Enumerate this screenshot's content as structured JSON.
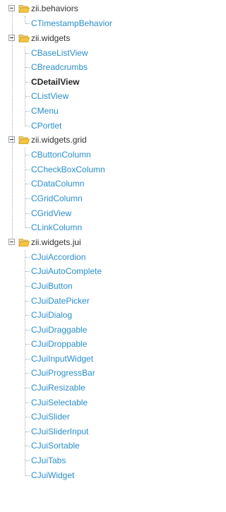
{
  "tree": {
    "groups": [
      {
        "label": "zii.behaviors",
        "items": [
          {
            "label": "CTimestampBehavior",
            "active": false
          }
        ]
      },
      {
        "label": "zii.widgets",
        "items": [
          {
            "label": "CBaseListView",
            "active": false
          },
          {
            "label": "CBreadcrumbs",
            "active": false
          },
          {
            "label": "CDetailView",
            "active": true
          },
          {
            "label": "CListView",
            "active": false
          },
          {
            "label": "CMenu",
            "active": false
          },
          {
            "label": "CPortlet",
            "active": false
          }
        ]
      },
      {
        "label": "zii.widgets.grid",
        "items": [
          {
            "label": "CButtonColumn",
            "active": false
          },
          {
            "label": "CCheckBoxColumn",
            "active": false
          },
          {
            "label": "CDataColumn",
            "active": false
          },
          {
            "label": "CGridColumn",
            "active": false
          },
          {
            "label": "CGridView",
            "active": false
          },
          {
            "label": "CLinkColumn",
            "active": false
          }
        ]
      },
      {
        "label": "zii.widgets.jui",
        "items": [
          {
            "label": "CJuiAccordion",
            "active": false
          },
          {
            "label": "CJuiAutoComplete",
            "active": false
          },
          {
            "label": "CJuiButton",
            "active": false
          },
          {
            "label": "CJuiDatePicker",
            "active": false
          },
          {
            "label": "CJuiDialog",
            "active": false
          },
          {
            "label": "CJuiDraggable",
            "active": false
          },
          {
            "label": "CJuiDroppable",
            "active": false
          },
          {
            "label": "CJuiInputWidget",
            "active": false
          },
          {
            "label": "CJuiProgressBar",
            "active": false
          },
          {
            "label": "CJuiResizable",
            "active": false
          },
          {
            "label": "CJuiSelectable",
            "active": false
          },
          {
            "label": "CJuiSlider",
            "active": false
          },
          {
            "label": "CJuiSliderInput",
            "active": false
          },
          {
            "label": "CJuiSortable",
            "active": false
          },
          {
            "label": "CJuiTabs",
            "active": false
          },
          {
            "label": "CJuiWidget",
            "active": false
          }
        ]
      }
    ],
    "icons": {
      "toggle": "collapse-minus-icon",
      "folder": "open-folder-icon"
    },
    "colors": {
      "link": "#2a8fcb",
      "active": "#222222",
      "group_label": "#333333",
      "folder_fill": "#f5c542",
      "folder_stroke": "#c9981f"
    }
  }
}
